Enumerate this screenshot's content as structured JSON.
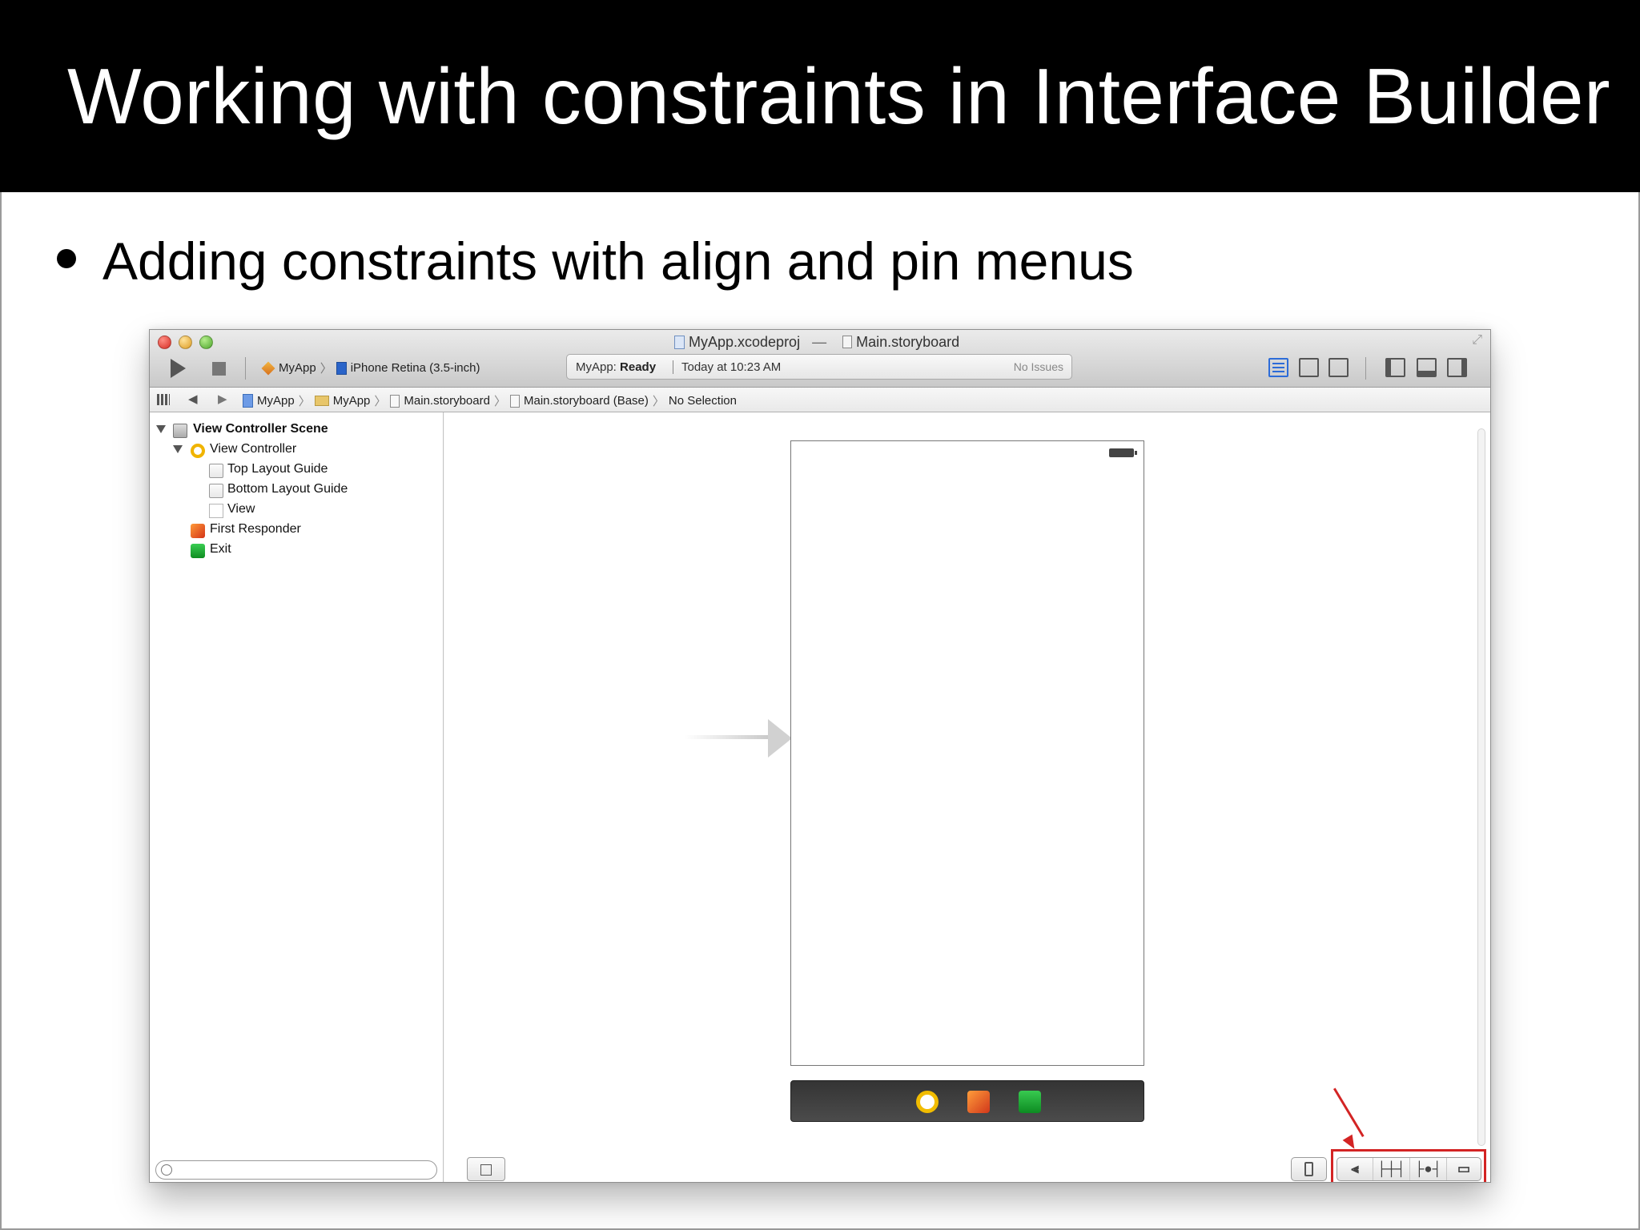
{
  "slide": {
    "title": "Working with constraints in Interface Builder",
    "bullet": "Adding constraints with align and pin menus"
  },
  "xcode": {
    "window": {
      "project": "MyApp.xcodeproj",
      "separator": "—",
      "document": "Main.storyboard"
    },
    "toolbar": {
      "scheme": "MyApp",
      "scheme_separator": "〉",
      "device": "iPhone Retina (3.5-inch)",
      "status_project": "MyApp:",
      "status_state": "Ready",
      "status_time": "Today at 10:23 AM",
      "issues": "No Issues"
    },
    "jumpbar": {
      "back": "◀",
      "forward": "▶",
      "separator": "〉",
      "crumbs": [
        "MyApp",
        "MyApp",
        "Main.storyboard",
        "Main.storyboard (Base)",
        "No Selection"
      ]
    },
    "outline": {
      "items": [
        {
          "label": "View Controller Scene"
        },
        {
          "label": "View Controller"
        },
        {
          "label": "Top Layout Guide"
        },
        {
          "label": "Bottom Layout Guide"
        },
        {
          "label": "View"
        },
        {
          "label": "First Responder"
        },
        {
          "label": "Exit"
        }
      ]
    },
    "bottom_controls": {
      "align_symbol": "⫷",
      "pin_symbol": "├┼┤",
      "resolve_symbol": "├●┤",
      "resizing_symbol": "▭",
      "zoom_out_symbol": "−",
      "fit_symbol": "=",
      "zoom_in_symbol": "+"
    }
  }
}
